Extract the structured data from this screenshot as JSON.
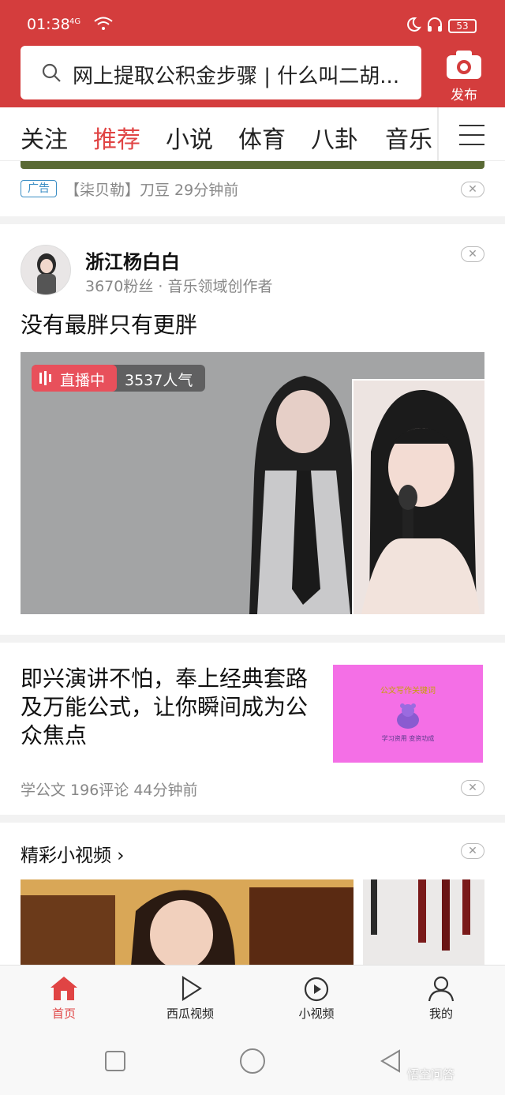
{
  "status": {
    "time": "01:38",
    "network": "4G",
    "battery": "53"
  },
  "search": {
    "query": "网上提取公积金步骤 | 什么叫二胡..."
  },
  "header": {
    "publish_label": "发布"
  },
  "tabs": [
    "关注",
    "推荐",
    "小说",
    "体育",
    "八卦",
    "音乐"
  ],
  "active_tab": "推荐",
  "ad": {
    "tag": "广告",
    "text": "【柒贝勒】刀豆  29分钟前"
  },
  "post": {
    "author": "浙江杨白白",
    "meta": "3670粉丝 · 音乐领域创作者",
    "title": "没有最胖只有更胖",
    "live_label": "直播中",
    "popularity": "3537人气"
  },
  "article": {
    "title": "即兴演讲不怕，奉上经典套路及万能公式，让你瞬间成为公众焦点",
    "thumb_title": "公文写作关键词",
    "thumb_sub": "学习资用    变资功成",
    "meta": "学公文  196评论  44分钟前"
  },
  "shortvideos": {
    "title": "精彩小视频 ›"
  },
  "bottom_nav": [
    {
      "label": "首页",
      "icon": "home-icon",
      "active": true
    },
    {
      "label": "西瓜视频",
      "icon": "play-icon",
      "active": false
    },
    {
      "label": "小视频",
      "icon": "short-video-icon",
      "active": false
    },
    {
      "label": "我的",
      "icon": "profile-icon",
      "active": false
    }
  ],
  "watermark": "悟空问答",
  "colors": {
    "brand_red": "#d43d3d",
    "active_red": "#e04444",
    "ad_blue": "#3a8dc4"
  }
}
